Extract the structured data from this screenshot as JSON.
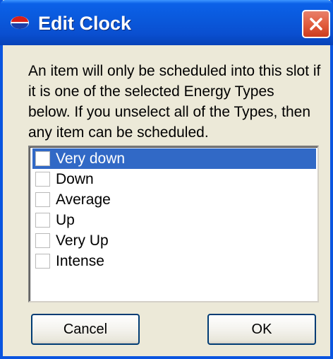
{
  "window": {
    "title": "Edit Clock",
    "icons": {
      "app": "app-logo-icon",
      "close": "close-icon"
    },
    "colors": {
      "titlebar": "#0A58DB",
      "close": "#E25E3F",
      "selection": "#3169C6",
      "face": "#ECE9D8"
    }
  },
  "description": {
    "lines": [
      "An item will only be scheduled into this slot if",
      "it is one of the selected Energy Types",
      "below. If you unselect all of the Types, then",
      "any item can be scheduled."
    ]
  },
  "energy_types": {
    "items": [
      {
        "label": "Very down",
        "checked": false,
        "selected": true
      },
      {
        "label": "Down",
        "checked": false,
        "selected": false
      },
      {
        "label": "Average",
        "checked": false,
        "selected": false
      },
      {
        "label": "Up",
        "checked": false,
        "selected": false
      },
      {
        "label": "Very Up",
        "checked": false,
        "selected": false
      },
      {
        "label": "Intense",
        "checked": false,
        "selected": false
      }
    ]
  },
  "buttons": {
    "cancel_label": "Cancel",
    "ok_label": "OK"
  }
}
